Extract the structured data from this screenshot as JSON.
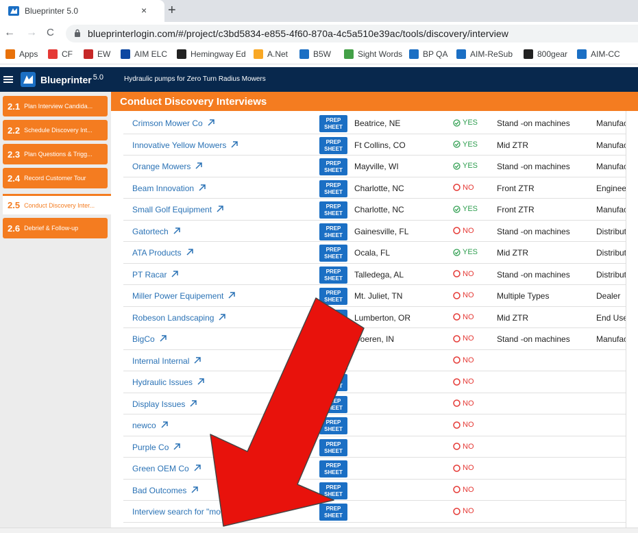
{
  "browser": {
    "tab_title": "Blueprinter 5.0",
    "tab_close": "×",
    "new_tab": "+",
    "url": "blueprinterlogin.com/#/project/c3bd5834-e855-4f60-870a-4c5a510e39ac/tools/discovery/interview",
    "back": "←",
    "forward": "→",
    "reload": "C",
    "bookmarks": [
      {
        "label": "Apps",
        "icon": "apps-grid-icon",
        "color": "#e8710a"
      },
      {
        "label": "CF",
        "icon": "cf-icon",
        "color": "#e53935"
      },
      {
        "label": "EW",
        "icon": "em-icon",
        "color": "#c62828"
      },
      {
        "label": "AIM ELC",
        "icon": "aim-elc-icon",
        "color": "#0d47a1"
      },
      {
        "label": "Hemingway Ed",
        "icon": "hemingway-icon",
        "color": "#222222"
      },
      {
        "label": "A.Net",
        "icon": "anet-icon",
        "color": "#f9a825"
      },
      {
        "label": "B5W",
        "icon": "blueprinter-icon",
        "color": "#1b6fc4"
      },
      {
        "label": "Sight Words",
        "icon": "sight-words-icon",
        "color": "#43a047"
      },
      {
        "label": "BP QA",
        "icon": "blueprinter-icon",
        "color": "#1b6fc4"
      },
      {
        "label": "AIM-ReSub",
        "icon": "aim-icon",
        "color": "#1b6fc4"
      },
      {
        "label": "800gear",
        "icon": "800gear-icon",
        "color": "#222222"
      },
      {
        "label": "AIM-CC",
        "icon": "aim-icon",
        "color": "#1b6fc4"
      }
    ]
  },
  "app": {
    "brand": "Blueprinter",
    "version": "5.0",
    "project": "Hydraulic pumps for Zero Turn Radius Mowers"
  },
  "sidebar": {
    "steps": [
      {
        "num": "2.1",
        "label": "Plan Interview Candida...",
        "active": false
      },
      {
        "num": "2.2",
        "label": "Schedule Discovery Int...",
        "active": false
      },
      {
        "num": "2.3",
        "label": "Plan Questions & Trigg...",
        "active": false
      },
      {
        "num": "2.4",
        "label": "Record Customer Tour",
        "active": false
      },
      {
        "num": "2.5",
        "label": "Conduct Discovery Inter...",
        "active": true
      },
      {
        "num": "2.6",
        "label": "Debrief & Follow-up",
        "active": false
      }
    ]
  },
  "main": {
    "title": "Conduct Discovery Interviews",
    "prep_label": "PREP SHEET",
    "prep_line1": "PREP",
    "prep_line2": "SHEET",
    "rows": [
      {
        "name": "Crimson Mower Co",
        "loc": "Beatrice, NE",
        "ans": "YES",
        "type": "Stand -on machines",
        "role": "Manufac"
      },
      {
        "name": "Innovative Yellow Mowers",
        "loc": "Ft Collins, CO",
        "ans": "YES",
        "type": "Mid ZTR",
        "role": "Manufac"
      },
      {
        "name": "Orange Mowers",
        "loc": "Mayville, WI",
        "ans": "YES",
        "type": "Stand -on machines",
        "role": "Manufac"
      },
      {
        "name": "Beam Innovation",
        "loc": "Charlotte, NC",
        "ans": "NO",
        "type": "Front ZTR",
        "role": "Engineer"
      },
      {
        "name": "Small Golf Equipment",
        "loc": "Charlotte, NC",
        "ans": "YES",
        "type": "Front ZTR",
        "role": "Manufac"
      },
      {
        "name": "Gatortech",
        "loc": "Gainesville, FL",
        "ans": "NO",
        "type": "Stand -on machines",
        "role": "Distribut"
      },
      {
        "name": "ATA Products",
        "loc": "Ocala, FL",
        "ans": "YES",
        "type": "Mid ZTR",
        "role": "Distribut"
      },
      {
        "name": "PT Racar",
        "loc": "Talledega, AL",
        "ans": "NO",
        "type": "Stand -on machines",
        "role": "Distribut"
      },
      {
        "name": "Miller Power Equipement",
        "loc": "Mt. Juliet, TN",
        "ans": "NO",
        "type": "Multiple Types",
        "role": "Dealer"
      },
      {
        "name": "Robeson Landscaping",
        "loc": "Lumberton, OR",
        "ans": "NO",
        "type": "Mid ZTR",
        "role": "End Use"
      },
      {
        "name": "BigCo",
        "loc": "Doeren, IN",
        "ans": "NO",
        "type": "Stand -on machines",
        "role": "Manufac"
      },
      {
        "name": "Internal Internal",
        "loc": "",
        "ans": "NO",
        "type": "",
        "role": ""
      },
      {
        "name": "Hydraulic Issues",
        "loc": "",
        "ans": "NO",
        "type": "",
        "role": ""
      },
      {
        "name": "Display Issues",
        "loc": "",
        "ans": "NO",
        "type": "",
        "role": ""
      },
      {
        "name": "newco",
        "loc": "",
        "ans": "NO",
        "type": "",
        "role": ""
      },
      {
        "name": "Purple Co",
        "loc": "",
        "ans": "NO",
        "type": "",
        "role": ""
      },
      {
        "name": "Green OEM Co",
        "loc": "",
        "ans": "NO",
        "type": "",
        "role": ""
      },
      {
        "name": "Bad Outcomes",
        "loc": "",
        "ans": "NO",
        "type": "",
        "role": ""
      },
      {
        "name": "Interview search for \"mower\"",
        "loc": "",
        "ans": "NO",
        "type": "",
        "role": ""
      }
    ]
  },
  "colors": {
    "orange": "#f47c20",
    "navy": "#08284d",
    "link": "#2a72b5",
    "yes": "#2e9e4f",
    "no": "#e53935",
    "annotation_arrow": "#e8120c"
  }
}
